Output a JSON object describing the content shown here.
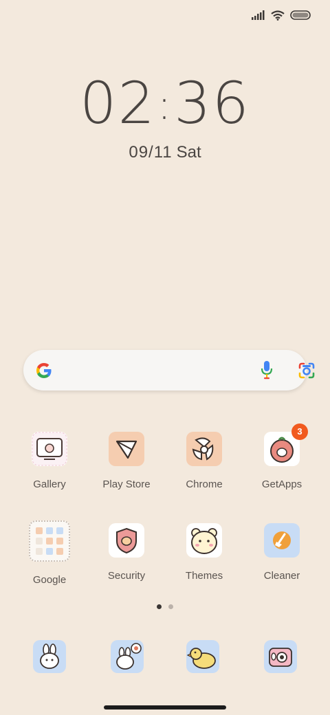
{
  "status_bar": {
    "icons": [
      "signal-icon",
      "wifi-icon",
      "battery-icon"
    ]
  },
  "clock": {
    "hours": "02",
    "separator": ":",
    "minutes": "36"
  },
  "date": {
    "day": "09/11",
    "weekday": "Sat"
  },
  "search": {
    "icons": [
      "google-logo-icon",
      "microphone-icon",
      "google-lens-icon"
    ]
  },
  "apps": [
    {
      "label": "Gallery"
    },
    {
      "label": "Play Store"
    },
    {
      "label": "Chrome"
    },
    {
      "label": "GetApps",
      "badge": "3"
    },
    {
      "label": "Google"
    },
    {
      "label": "Security"
    },
    {
      "label": "Themes"
    },
    {
      "label": "Cleaner"
    }
  ],
  "pager": {
    "pages": 2,
    "current": 1
  },
  "dock": {
    "icons": [
      "bunny-icon",
      "bunny-message-icon",
      "duck-icon",
      "camera-icon"
    ]
  },
  "colors": {
    "background": "#f3e9dd",
    "badge": "#f15a1e",
    "accent_peach": "#f5cdb0",
    "accent_blue": "#c8dcf5"
  }
}
